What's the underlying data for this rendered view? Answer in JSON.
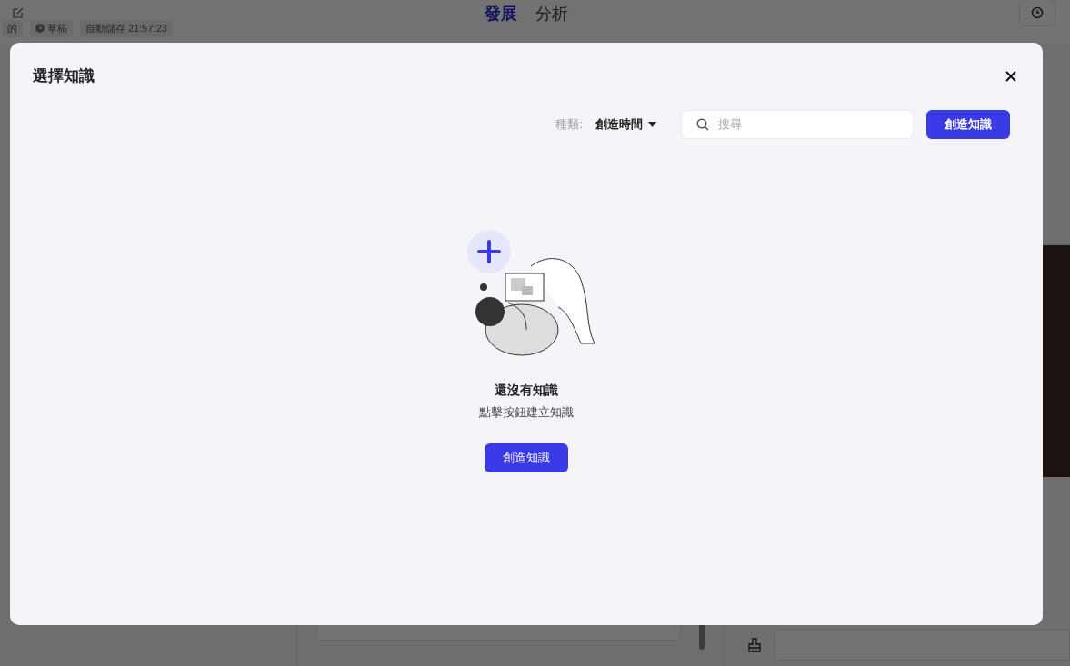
{
  "background_page": {
    "header": {
      "tags": [
        {
          "kind": "text",
          "label": "的"
        },
        {
          "kind": "status",
          "label": "草稿"
        },
        {
          "kind": "text",
          "label": "自動儲存 21:57:23"
        }
      ],
      "tabs": [
        {
          "label": "發展",
          "selected": true
        },
        {
          "label": "分析",
          "selected": false
        }
      ]
    }
  },
  "dialog": {
    "title": "選擇知識",
    "filter": {
      "label": "種類:",
      "value": "創造時間"
    },
    "search": {
      "placeholder": "搜尋"
    },
    "create_button": "創造知識",
    "empty_state": {
      "title": "還沒有知識",
      "subtitle": "點擊按鈕建立知識",
      "button": "創造知識"
    }
  }
}
